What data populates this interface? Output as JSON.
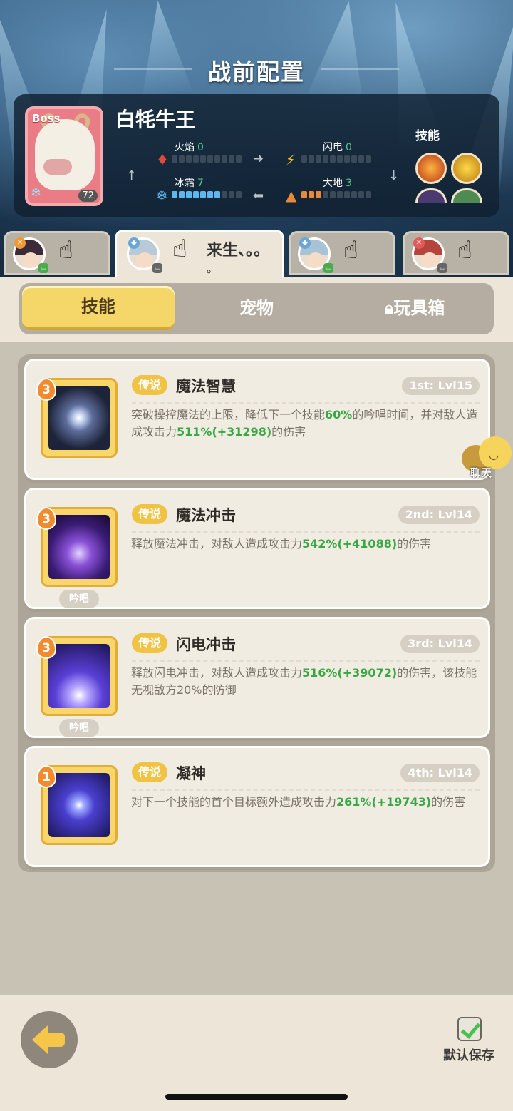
{
  "title": "战前配置",
  "boss": {
    "tag": "Boss",
    "name": "白牦牛王",
    "level": "72",
    "stats": [
      {
        "label": "火焰",
        "value": "0",
        "color": "#e04a3c",
        "icon": "fire-icon"
      },
      {
        "label": "闪电",
        "value": "0",
        "color": "#f1c232",
        "icon": "lightning-icon"
      },
      {
        "label": "冰霜",
        "value": "7",
        "color": "#5fb7ef",
        "icon": "frost-icon"
      },
      {
        "label": "大地",
        "value": "3",
        "color": "#e8893a",
        "icon": "earth-icon"
      }
    ],
    "skills_label": "技能"
  },
  "characters": [
    {
      "name": "",
      "name_line2": "",
      "hair_color": "#3a2a3a",
      "badge_color": "#f09a35",
      "ctrl_color": "#4aaa4d"
    },
    {
      "name": "来生、。。",
      "name_line2": "。",
      "hair_color": "#b8c9d8",
      "badge_color": "#6aa7d6",
      "ctrl_color": "#666"
    },
    {
      "name": "",
      "name_line2": "",
      "hair_color": "#a9c3d6",
      "badge_color": "#6aa7d6",
      "ctrl_color": "#4aaa4d"
    },
    {
      "name": "",
      "name_line2": "",
      "hair_color": "#b5453c",
      "badge_color": "#e25a5a",
      "ctrl_color": "#666"
    }
  ],
  "tabs": {
    "skills": "技能",
    "pets": "宠物",
    "toybox": "玩具箱"
  },
  "skills": [
    {
      "rank": "3",
      "rarity": "传说",
      "name": "魔法智慧",
      "level": "1st: Lvl15",
      "chant": "",
      "desc_parts": [
        "突破操控魔法的上限，降低下一个技能",
        "60%",
        "的吟唱时间，并对敌人造成攻击力",
        "511%(+31298)",
        "的伤害"
      ]
    },
    {
      "rank": "3",
      "rarity": "传说",
      "name": "魔法冲击",
      "level": "2nd: Lvl14",
      "chant": "吟唱",
      "desc_parts": [
        "释放魔法冲击，对敌人造成攻击力",
        "542%(+41088)",
        "的伤害",
        "",
        ""
      ]
    },
    {
      "rank": "3",
      "rarity": "传说",
      "name": "闪电冲击",
      "level": "3rd: Lvl14",
      "chant": "吟唱",
      "desc_parts": [
        "释放闪电冲击，对敌人造成攻击力",
        "516%(+39072)",
        "的伤害，该技能无视敌方20%的防御",
        "",
        ""
      ]
    },
    {
      "rank": "1",
      "rarity": "传说",
      "name": "凝神",
      "level": "4th: Lvl14",
      "chant": "",
      "desc_parts": [
        "对下一个技能的首个目标额外造成攻击力",
        "261%(+19743)",
        "的伤害",
        "",
        ""
      ]
    }
  ],
  "chat_label": "聊天",
  "footer": {
    "save_label": "默认保存"
  }
}
